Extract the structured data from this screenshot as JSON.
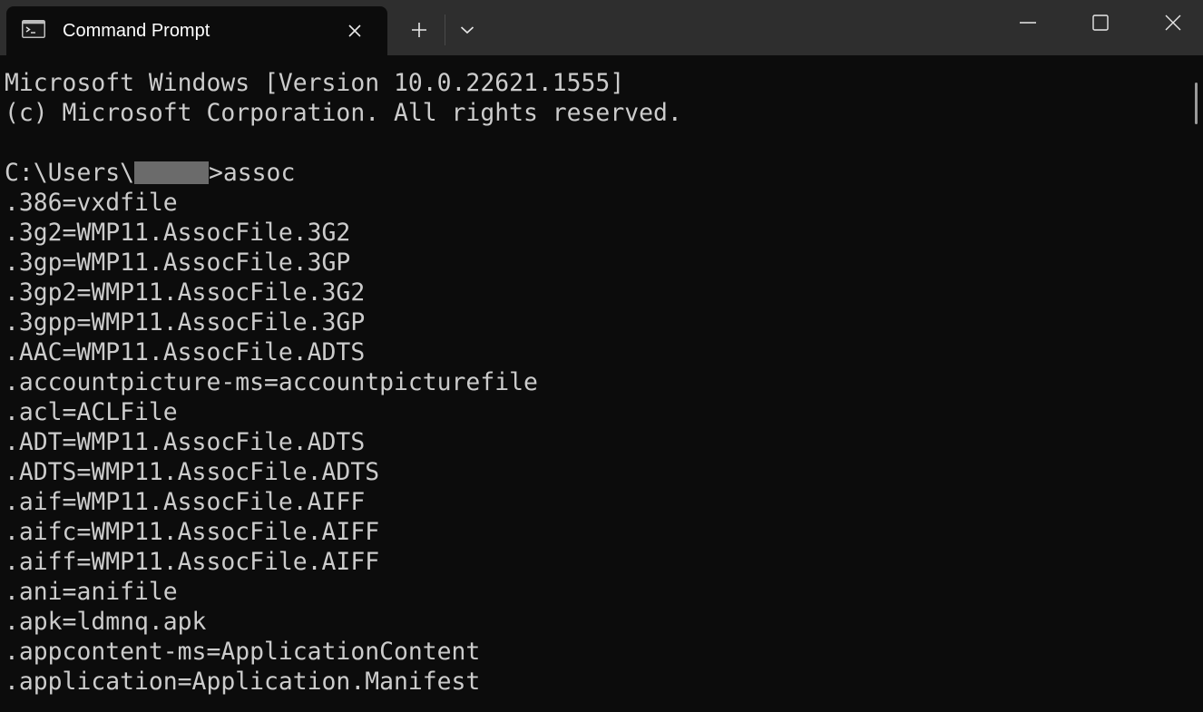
{
  "window": {
    "tab_title": "Command Prompt",
    "tab_icon": "command-prompt-icon",
    "new_tab_icon": "plus-icon",
    "dropdown_icon": "chevron-down-icon",
    "minimize_icon": "minimize-icon",
    "maximize_icon": "maximize-icon",
    "close_icon": "close-icon"
  },
  "terminal": {
    "header_line1": "Microsoft Windows [Version 10.0.22621.1555]",
    "header_line2": "(c) Microsoft Corporation. All rights reserved.",
    "prompt_prefix": "C:\\Users\\",
    "prompt_suffix": ">assoc",
    "output": [
      ".386=vxdfile",
      ".3g2=WMP11.AssocFile.3G2",
      ".3gp=WMP11.AssocFile.3GP",
      ".3gp2=WMP11.AssocFile.3G2",
      ".3gpp=WMP11.AssocFile.3GP",
      ".AAC=WMP11.AssocFile.ADTS",
      ".accountpicture-ms=accountpicturefile",
      ".acl=ACLFile",
      ".ADT=WMP11.AssocFile.ADTS",
      ".ADTS=WMP11.AssocFile.ADTS",
      ".aif=WMP11.AssocFile.AIFF",
      ".aifc=WMP11.AssocFile.AIFF",
      ".aiff=WMP11.AssocFile.AIFF",
      ".ani=anifile",
      ".apk=ldmnq.apk",
      ".appcontent-ms=ApplicationContent",
      ".application=Application.Manifest"
    ]
  },
  "colors": {
    "background": "#0c0c0c",
    "titlebar": "#2e2e2e",
    "text": "#cccccc"
  }
}
